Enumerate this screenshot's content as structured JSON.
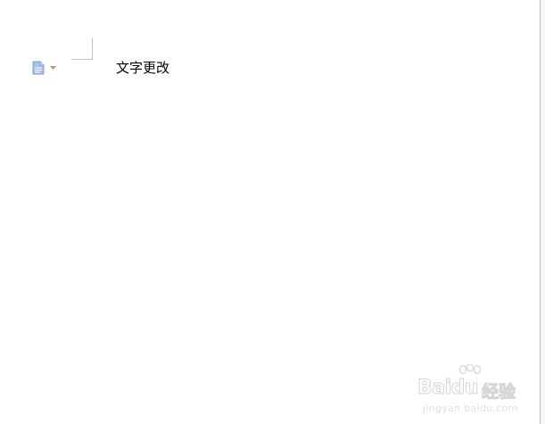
{
  "document": {
    "body_text": "文字更改"
  },
  "icons": {
    "doc_menu": "document-icon",
    "doc_menu_arrow": "caret-down-icon"
  },
  "watermark": {
    "brand": "Bai",
    "paw_letters": "du",
    "chinese": "经验",
    "url": "jingyan.baidu.com"
  },
  "colors": {
    "icon_blue": "#7ea0d6",
    "text": "#000000",
    "margin_mark": "#bfbfbf"
  }
}
